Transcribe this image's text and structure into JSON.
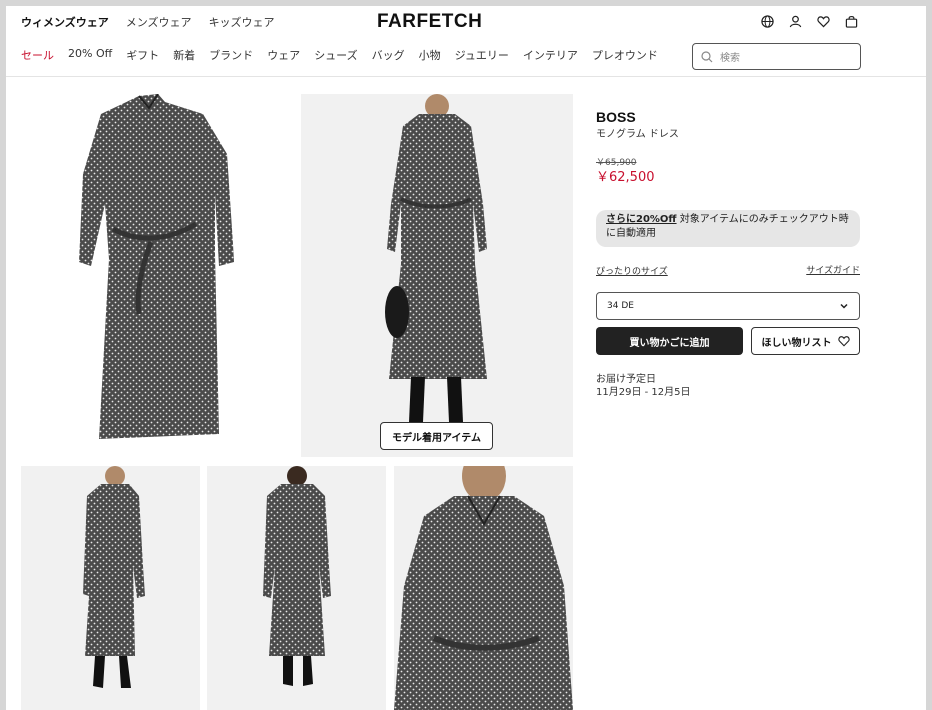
{
  "header": {
    "gender_tabs": [
      "ウィメンズウェア",
      "メンズウェア",
      "キッズウェア"
    ],
    "logo": "FARFETCH",
    "categories": [
      "セール",
      "20% Off",
      "ギフト",
      "新着",
      "ブランド",
      "ウェア",
      "シューズ",
      "バッグ",
      "小物",
      "ジュエリー",
      "インテリア",
      "プレオウンド"
    ],
    "search_placeholder": "検索",
    "icons": [
      "globe-icon",
      "account-icon",
      "heart-icon",
      "bag-icon"
    ]
  },
  "gallery": {
    "model_button": "モデル着用アイテム"
  },
  "product": {
    "brand": "BOSS",
    "name": "モノグラム ドレス",
    "old_price": "￥65,900",
    "price": "￥62,500",
    "promo_strong": "さらに20%Off",
    "promo_text": " 対象アイテムにのみチェックアウト時に自動適用",
    "size_fit": "ぴったりのサイズ",
    "size_guide": "サイズガイド",
    "size_selected": "34 DE",
    "add_to_bag": "買い物かごに追加",
    "wishlist": "ほしい物リスト",
    "delivery_label": "お届け予定日",
    "delivery_dates": "11月29日 - 12月5日"
  },
  "colors": {
    "sale_red": "#c8102e",
    "button_dark": "#222222",
    "promo_bg": "#e6e6e6"
  }
}
